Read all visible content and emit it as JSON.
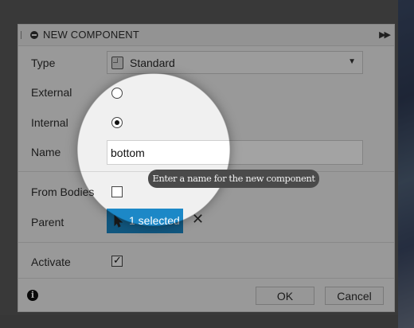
{
  "dialog": {
    "title": "NEW COMPONENT",
    "icons": {
      "collapse": "minus-circle-icon",
      "expand": "double-chevron-right-icon",
      "info": "info-icon",
      "component": "component-icon",
      "cursor": "cursor-arrow-icon",
      "close": "close-icon",
      "dropdown": "chevron-down-icon"
    }
  },
  "fields": {
    "type": {
      "label": "Type",
      "value": "Standard"
    },
    "external": {
      "label": "External",
      "checked": false
    },
    "internal": {
      "label": "Internal",
      "checked": true
    },
    "name": {
      "label": "Name",
      "value": "bottom",
      "tooltip": "Enter a name for the new component"
    },
    "from_bodies": {
      "label": "From Bodies",
      "checked": false
    },
    "parent": {
      "label": "Parent",
      "selection": "1 selected"
    },
    "activate": {
      "label": "Activate",
      "checked": true
    }
  },
  "buttons": {
    "ok": "OK",
    "cancel": "Cancel"
  },
  "colors": {
    "accent": "#1c88c7",
    "dialog_bg": "#f0f0f0",
    "backdrop": "#5a5a5a"
  }
}
